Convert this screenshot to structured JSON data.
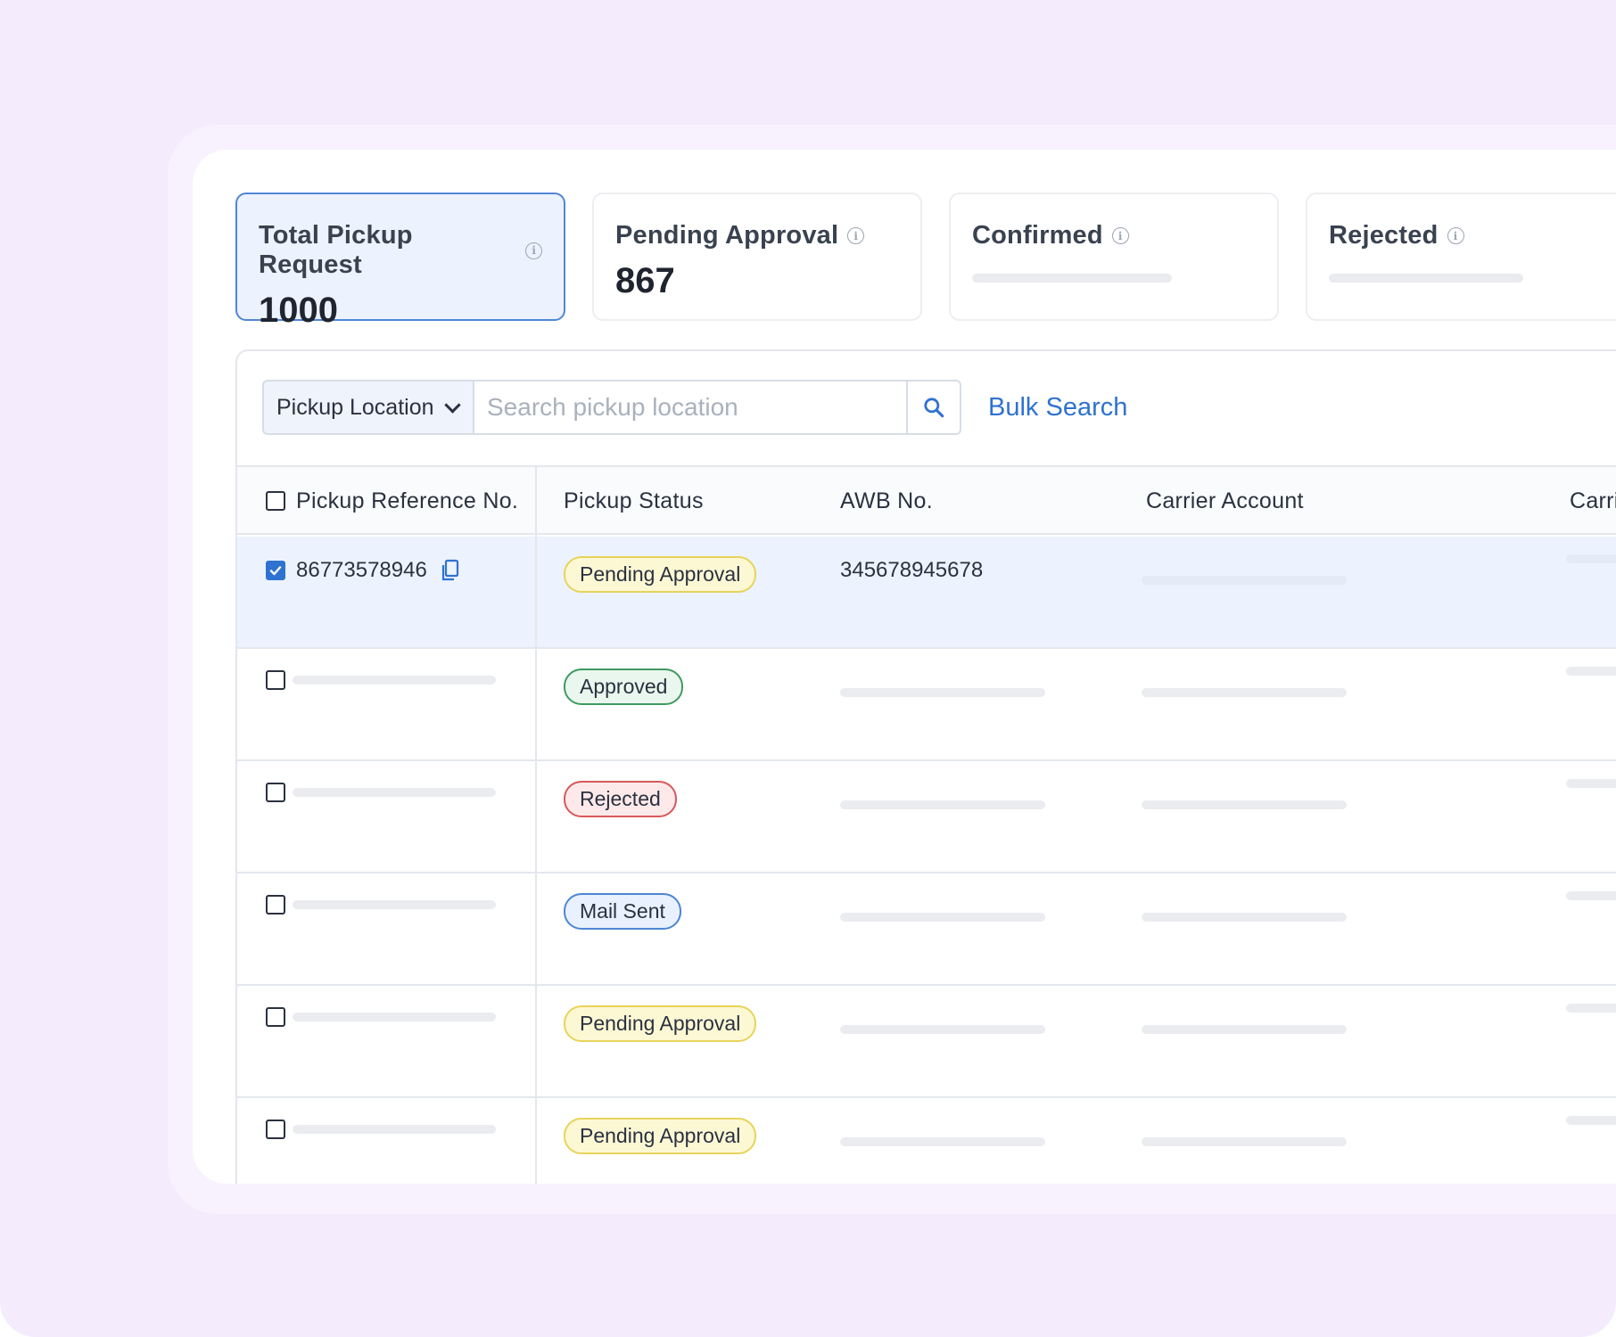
{
  "stats": [
    {
      "title": "Total Pickup Request",
      "value": "1000",
      "active": true
    },
    {
      "title": "Pending Approval",
      "value": "867",
      "active": false
    },
    {
      "title": "Confirmed",
      "value": null,
      "active": false
    },
    {
      "title": "Rejected",
      "value": null,
      "active": false
    }
  ],
  "toolbar": {
    "filter_label": "Pickup Location",
    "search_placeholder": "Search pickup location",
    "bulk_search_label": "Bulk Search"
  },
  "table": {
    "columns": [
      "Pickup Reference No.",
      "Pickup Status",
      "AWB No.",
      "Carrier Account",
      "Carri"
    ],
    "rows": [
      {
        "selected": true,
        "reference": "86773578946",
        "status": "Pending Approval",
        "awb": "345678945678"
      },
      {
        "selected": false,
        "reference": null,
        "status": "Approved",
        "awb": null
      },
      {
        "selected": false,
        "reference": null,
        "status": "Rejected",
        "awb": null
      },
      {
        "selected": false,
        "reference": null,
        "status": "Mail Sent",
        "awb": null
      },
      {
        "selected": false,
        "reference": null,
        "status": "Pending Approval",
        "awb": null
      },
      {
        "selected": false,
        "reference": null,
        "status": "Pending Approval",
        "awb": null
      }
    ]
  },
  "status_colors": {
    "Pending Approval": {
      "bg": "#fdf8d4",
      "border": "#e8d35a",
      "text": "#2a3140"
    },
    "Approved": {
      "bg": "#e9f7ee",
      "border": "#3f9a61",
      "text": "#2a3140"
    },
    "Rejected": {
      "bg": "#fde9e9",
      "border": "#d8585a",
      "text": "#2a3140"
    },
    "Mail Sent": {
      "bg": "#e8f1fd",
      "border": "#4d86d3",
      "text": "#2a3140"
    }
  },
  "icons": {
    "info": "info-icon",
    "dropdown": "chevron-down-icon",
    "search": "search-icon",
    "copy": "copy-icon",
    "check": "check-icon"
  }
}
